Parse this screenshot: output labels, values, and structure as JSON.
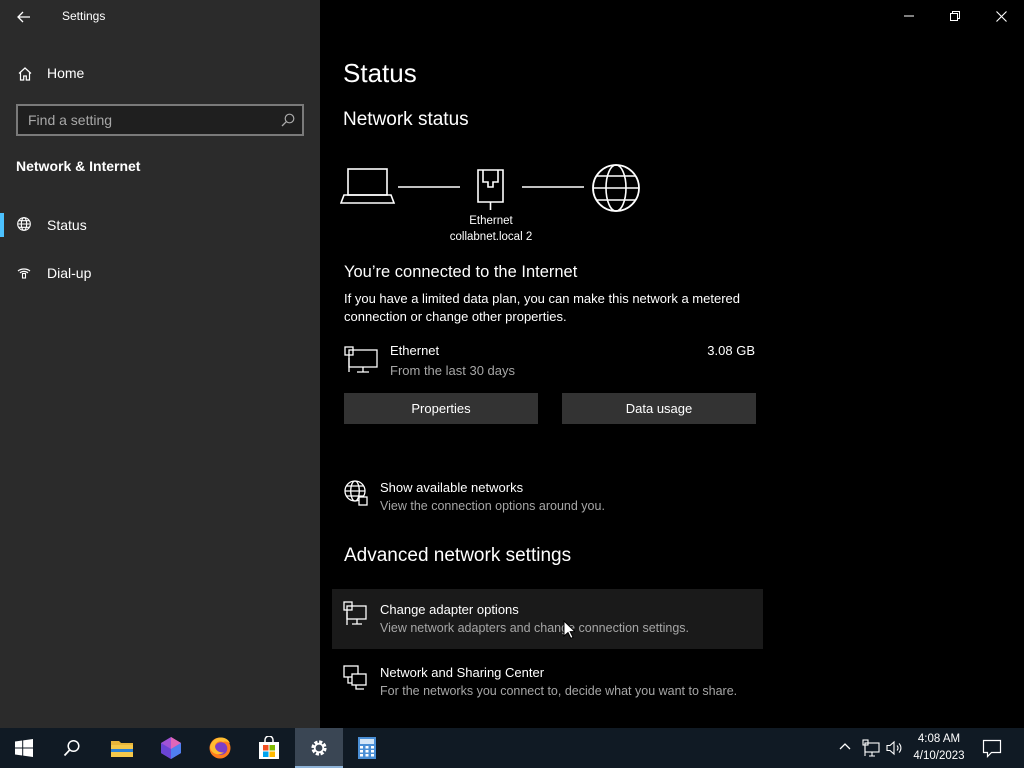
{
  "window": {
    "app_title": "Settings",
    "back_icon": "back-arrow-icon",
    "controls": [
      "minimize-icon",
      "restore-icon",
      "close-icon"
    ]
  },
  "sidebar": {
    "home_label": "Home",
    "search_placeholder": "Find a setting",
    "section_title": "Network & Internet",
    "items": [
      {
        "label": "Status",
        "icon": "globe-status-icon",
        "selected": true
      },
      {
        "label": "Dial-up",
        "icon": "dialup-icon",
        "selected": false
      }
    ],
    "accent_color": "#4cc2ff"
  },
  "main": {
    "page_title": "Status",
    "network_status_title": "Network status",
    "diagram": {
      "connection_name": "Ethernet",
      "network_name": "collabnet.local 2"
    },
    "connected_heading": "You’re connected to the Internet",
    "connected_desc": "If you have a limited data plan, you can make this network a metered connection or change other properties.",
    "ethernet": {
      "name": "Ethernet",
      "period": "From the last 30 days",
      "usage": "3.08 GB"
    },
    "buttons": {
      "properties": "Properties",
      "data_usage": "Data usage"
    },
    "show_networks": {
      "title": "Show available networks",
      "desc": "View the connection options around you."
    },
    "advanced_title": "Advanced network settings",
    "adapter_options": {
      "title": "Change adapter options",
      "desc": "View network adapters and change connection settings."
    },
    "sharing_center": {
      "title": "Network and Sharing Center",
      "desc": "For the networks you connect to, decide what you want to share."
    }
  },
  "taskbar": {
    "apps": [
      "windows-start-icon",
      "search-icon",
      "file-explorer-icon",
      "app-gem-icon",
      "firefox-icon",
      "microsoft-store-icon",
      "settings-gear-icon",
      "calculator-icon"
    ],
    "active_app": "settings-gear-icon",
    "time": "4:08 AM",
    "date": "4/10/2023"
  }
}
